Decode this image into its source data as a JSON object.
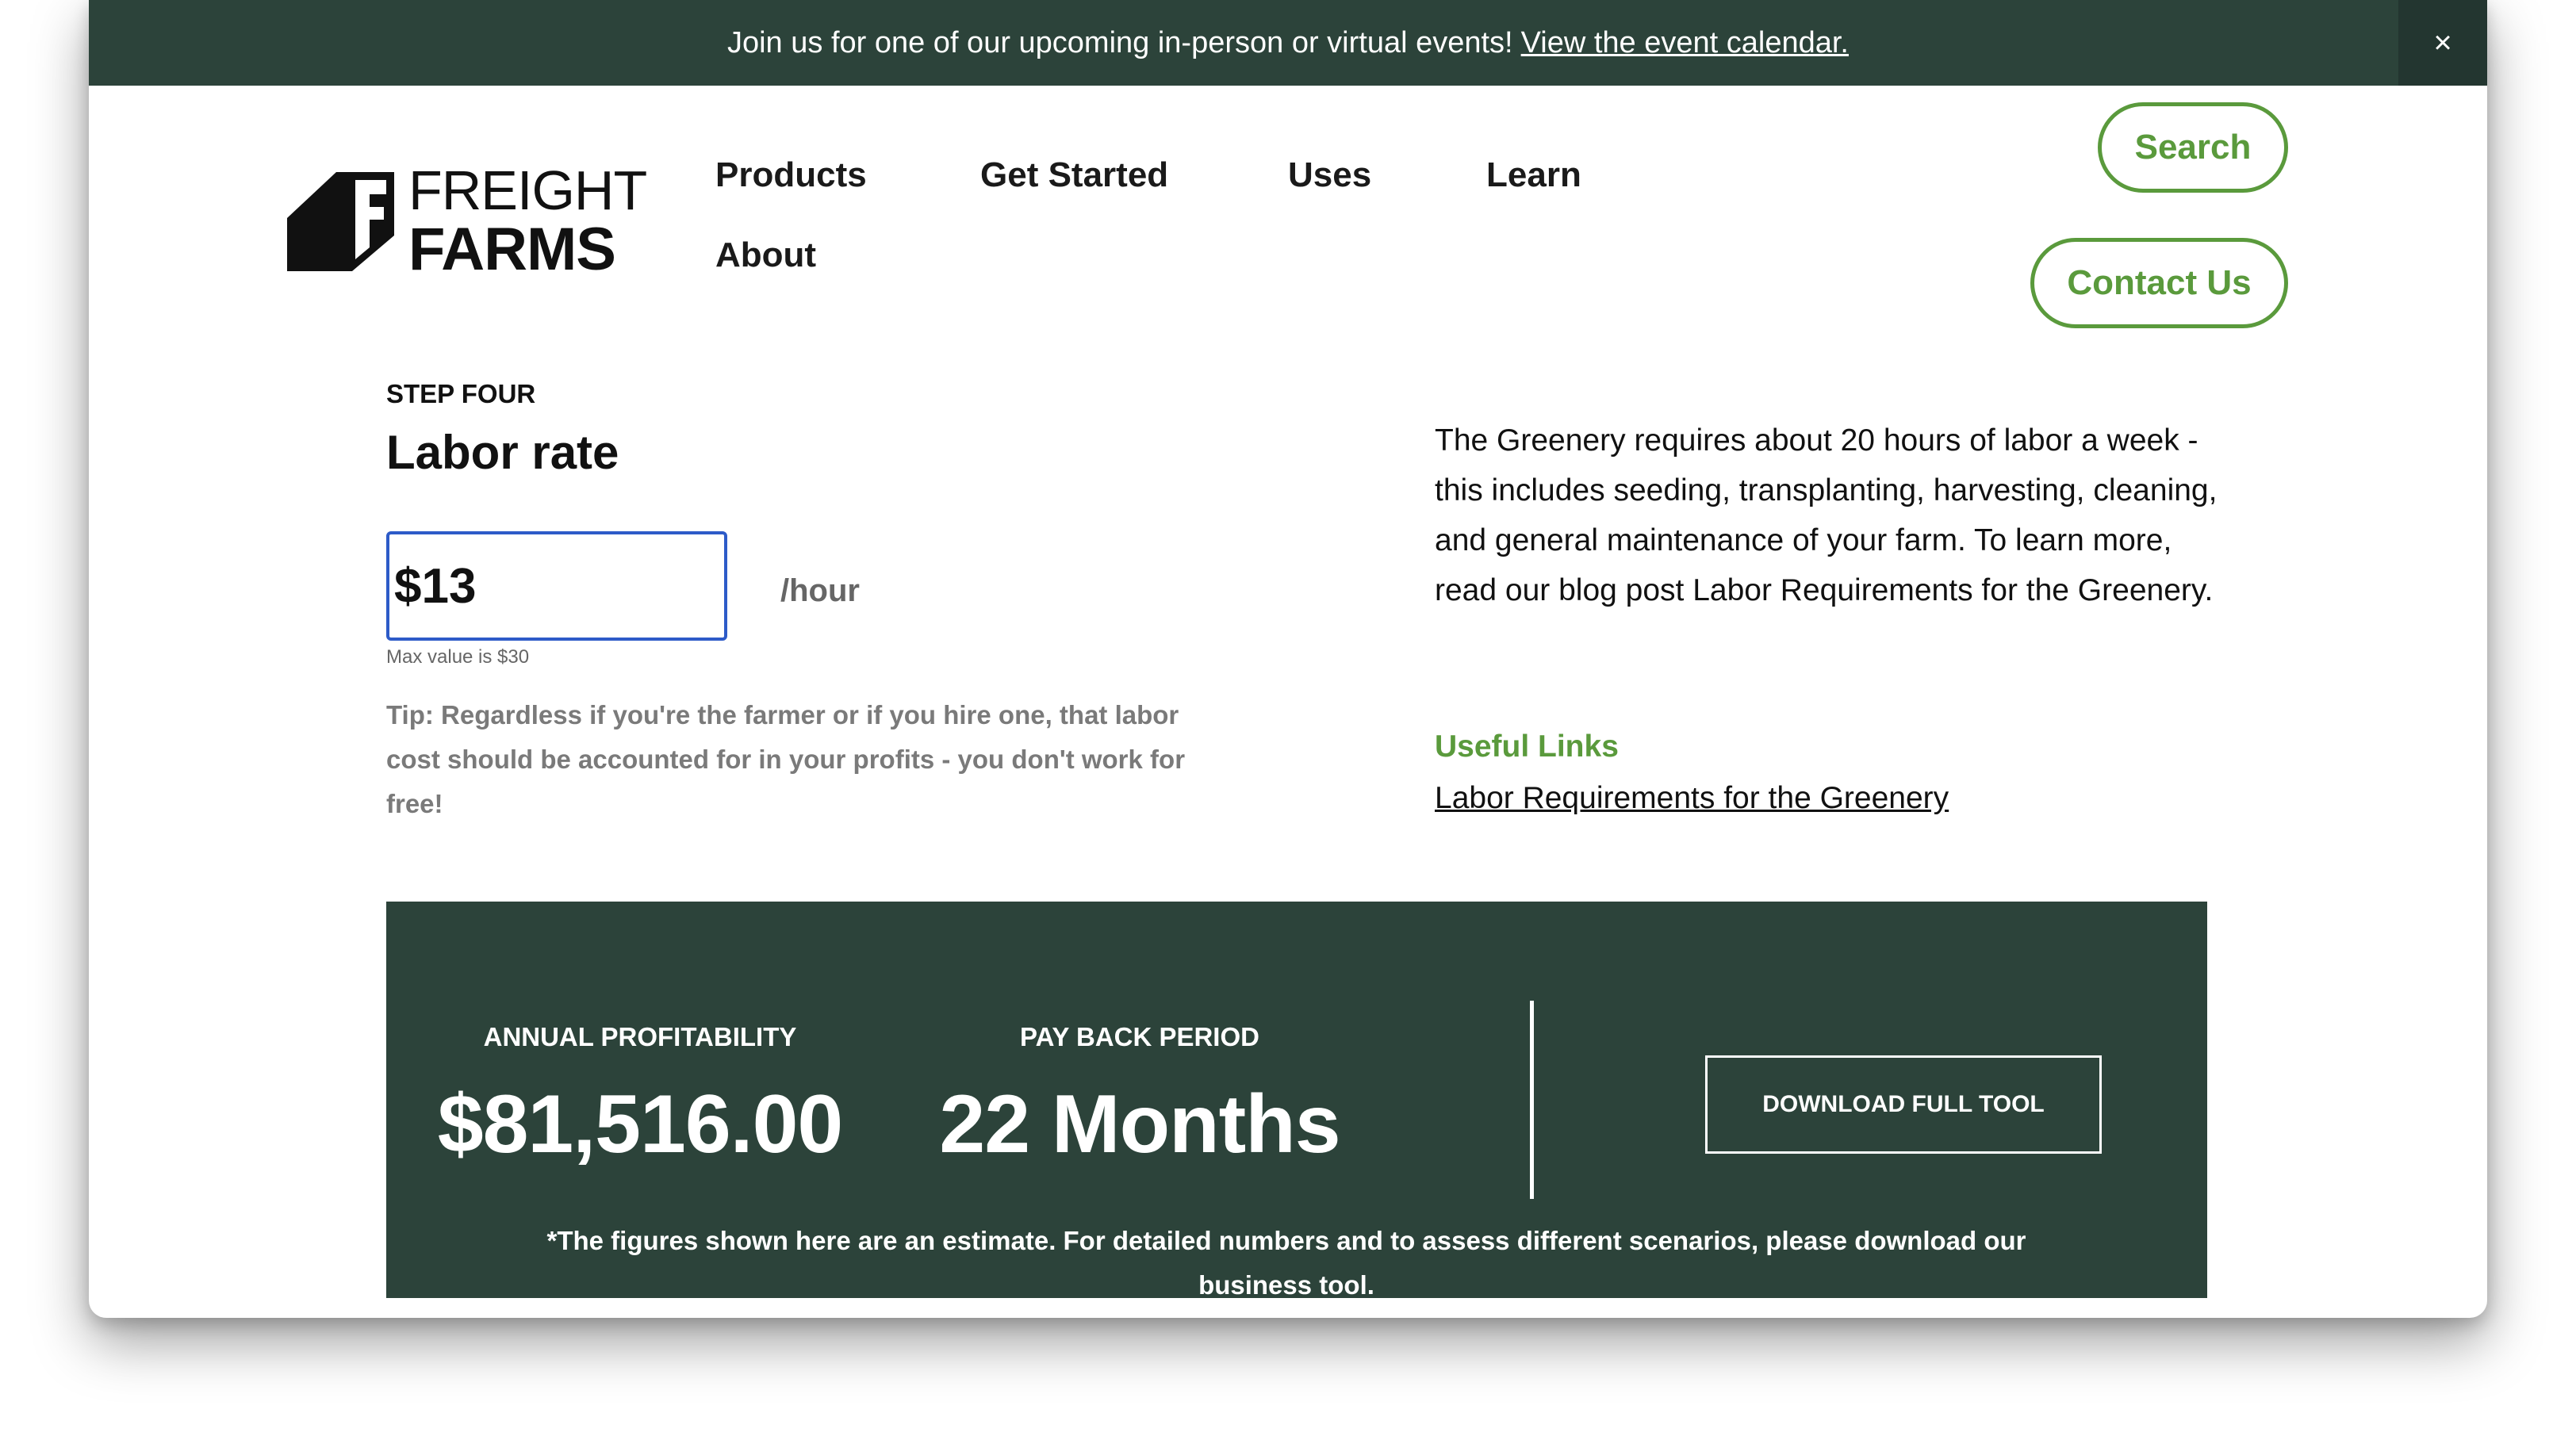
{
  "banner": {
    "text": "Join us for one of our upcoming in-person or virtual events!",
    "link_label": "View the event calendar.",
    "close_label": "×"
  },
  "logo": {
    "line1": "FREIGHT",
    "line2": "FARMS"
  },
  "nav": {
    "items": [
      {
        "label": "Products"
      },
      {
        "label": "Get Started"
      },
      {
        "label": "Uses"
      },
      {
        "label": "Learn"
      },
      {
        "label": "About"
      }
    ],
    "search_label": "Search",
    "contact_label": "Contact Us"
  },
  "step": {
    "label": "STEP FOUR",
    "title": "Labor rate",
    "input_value": "$13",
    "unit": "/hour",
    "max_hint": "Max value is $30",
    "tip": "Tip: Regardless if you're the farmer or if you hire one, that labor cost should be accounted for in your profits - you don't work for free!"
  },
  "info": {
    "description": "The Greenery requires about 20 hours of labor a week - this includes seeding, transplanting, harvesting, cleaning, and general maintenance of your farm. To learn more, read our blog post Labor Requirements for the Greenery.",
    "useful_links_title": "Useful Links",
    "links": [
      {
        "label": "Labor Requirements for the Greenery"
      }
    ]
  },
  "results": {
    "annual_label": "ANNUAL PROFITABILITY",
    "annual_value": "$81,516.00",
    "payback_label": "PAY BACK PERIOD",
    "payback_value": "22 Months",
    "download_label": "DOWNLOAD FULL TOOL",
    "disclaimer": "*The figures shown here are an estimate. For detailed numbers and to assess different scenarios, please download our business tool."
  },
  "colors": {
    "banner_bg": "#2c433a",
    "accent_green": "#5a9a3c",
    "input_border": "#2d5bc8"
  }
}
